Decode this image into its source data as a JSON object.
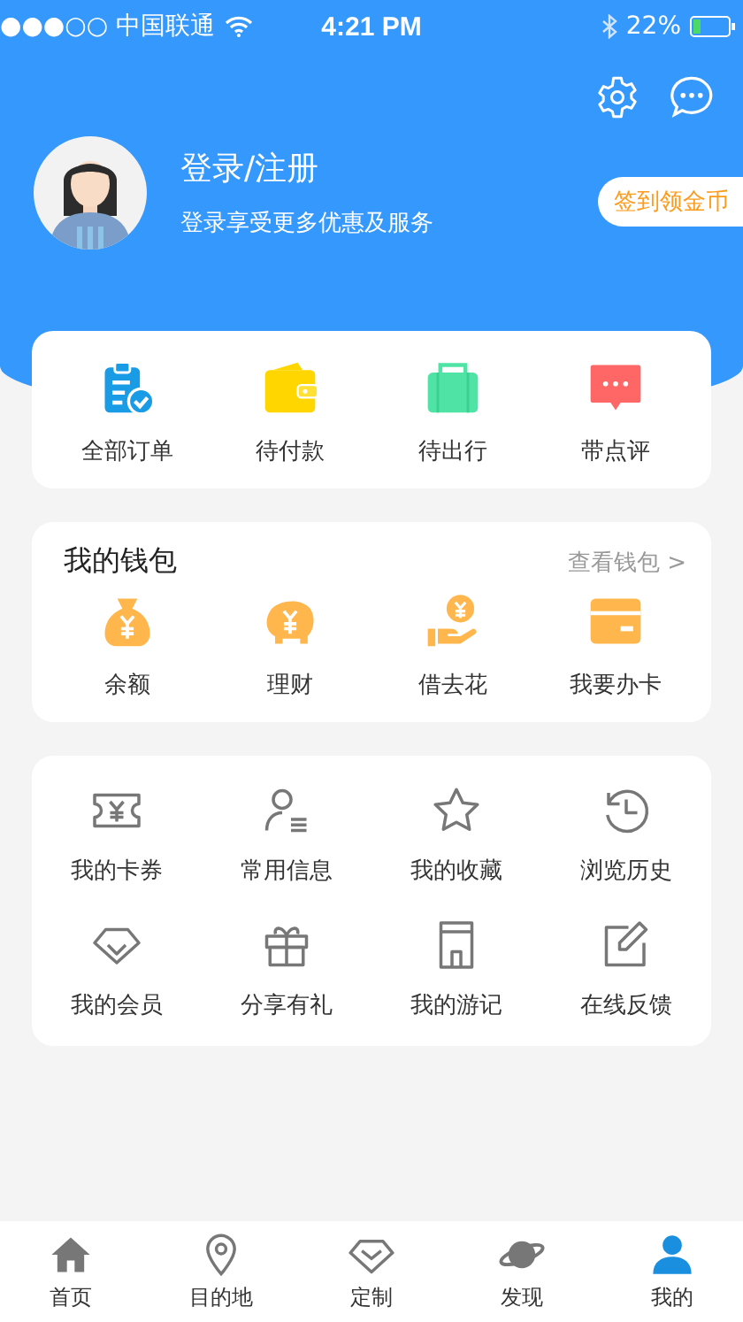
{
  "status_bar": {
    "carrier": "●●●○○ 中国联通",
    "time": "4:21 PM",
    "battery": "22%"
  },
  "profile": {
    "title": "登录/注册",
    "subtitle": "登录享受更多优惠及服务",
    "checkin_button": "签到领金币"
  },
  "orders": [
    {
      "label": "全部订单"
    },
    {
      "label": "待付款"
    },
    {
      "label": "待出行"
    },
    {
      "label": "带点评"
    }
  ],
  "wallet": {
    "title": "我的钱包",
    "link": "查看钱包 >",
    "items": [
      {
        "label": "余额"
      },
      {
        "label": "理财"
      },
      {
        "label": "借去花"
      },
      {
        "label": "我要办卡"
      }
    ]
  },
  "services": [
    {
      "label": "我的卡券"
    },
    {
      "label": "常用信息"
    },
    {
      "label": "我的收藏"
    },
    {
      "label": "浏览历史"
    },
    {
      "label": "我的会员"
    },
    {
      "label": "分享有礼"
    },
    {
      "label": "我的游记"
    },
    {
      "label": "在线反馈"
    }
  ],
  "tab_bar": [
    {
      "label": "首页",
      "selected": false
    },
    {
      "label": "目的地",
      "selected": false
    },
    {
      "label": "定制",
      "selected": false
    },
    {
      "label": "发现",
      "selected": false
    },
    {
      "label": "我的",
      "selected": true
    }
  ]
}
